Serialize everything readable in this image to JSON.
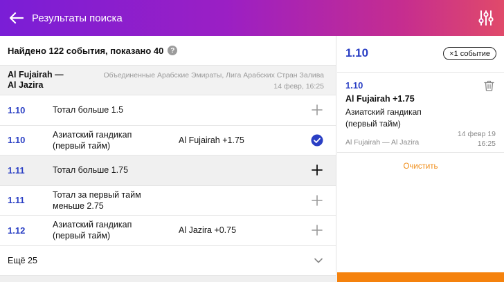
{
  "header": {
    "title": "Результаты поиска",
    "gradient_colors": [
      "#7a1ed6",
      "#e04a6a"
    ]
  },
  "results": {
    "found_text": "Найдено 122 события, показано 40",
    "help_symbol": "?"
  },
  "match": {
    "name": "Al Fujairah — Al Jazira",
    "league": "Объединенные Арабские Эмираты, Лига Арабских Стран Залива",
    "date": "14 февр, 16:25"
  },
  "bets": [
    {
      "odd": "1.10",
      "market_line1": "Тотал больше 1.5",
      "market_line2": "",
      "selection": "",
      "state": "add"
    },
    {
      "odd": "1.10",
      "market_line1": "Азиатский гандикап",
      "market_line2": "(первый тайм)",
      "selection": "Al Fujairah +1.75",
      "state": "selected"
    },
    {
      "odd": "1.11",
      "market_line1": "Тотал больше 1.75",
      "market_line2": "",
      "selection": "",
      "state": "add-hover"
    },
    {
      "odd": "1.11",
      "market_line1": "Тотал за первый тайм",
      "market_line2": "меньше 2.75",
      "selection": "",
      "state": "add"
    },
    {
      "odd": "1.12",
      "market_line1": "Азиатский гандикап",
      "market_line2": "(первый тайм)",
      "selection": "Al Jazira +0.75",
      "state": "add"
    }
  ],
  "more": {
    "label": "Ещё 25"
  },
  "slip": {
    "total_odd": "1.10",
    "count_label": "×1 событие",
    "item": {
      "odd": "1.10",
      "selection": "Al Fujairah +1.75",
      "market": "Азиатский гандикап (первый тайм)",
      "match": "Al Fujairah — Al Jazira",
      "date_line1": "14 февр 19",
      "date_line2": "16:25"
    },
    "clear_label": "Очистить"
  },
  "colors": {
    "odd_blue": "#2a3fc4",
    "accent_orange": "#f08c16",
    "check_blue": "#2a3fc4"
  },
  "icons": {
    "back": "arrow-left-icon",
    "filter": "sliders-icon",
    "help": "help-icon",
    "add": "plus-icon",
    "selected": "check-circle-icon",
    "more": "chevron-down-icon",
    "delete": "trash-icon"
  }
}
